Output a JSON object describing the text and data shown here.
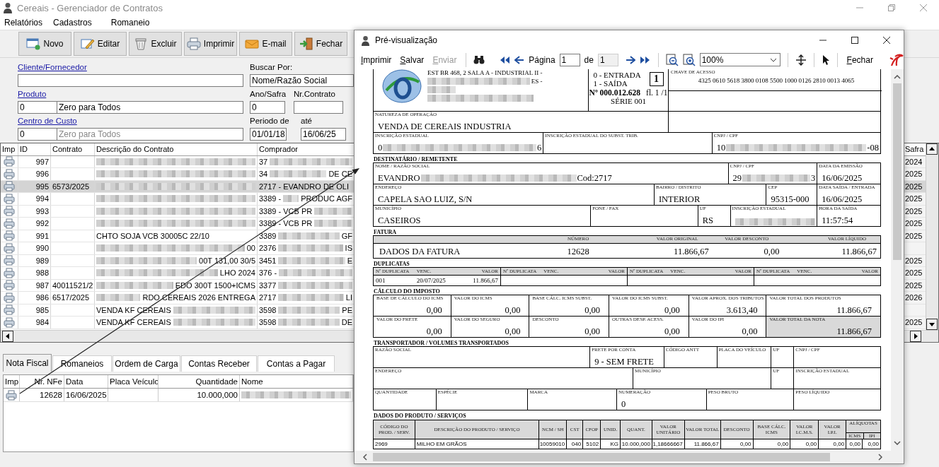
{
  "window": {
    "title": "Cereais - Gerenciador de Contratos"
  },
  "menu": [
    {
      "label": "Relatórios"
    },
    {
      "label": "Cadastros"
    },
    {
      "label": "Romaneio"
    }
  ],
  "toolbar": [
    {
      "label": "Novo",
      "kind": "new"
    },
    {
      "label": "Editar",
      "kind": "edit"
    },
    {
      "label": "Excluir",
      "kind": "delete"
    },
    {
      "label": "Imprimir",
      "kind": "print"
    },
    {
      "label": "E-mail",
      "kind": "email"
    },
    {
      "label": "Fechar",
      "kind": "close"
    }
  ],
  "filters": {
    "client": {
      "label": "Cliente/Fornecedor"
    },
    "search_by": {
      "label": "Buscar Por:",
      "value": "Nome/Razão Social"
    },
    "product": {
      "label": "Produto",
      "code": "0",
      "value": "Zero para Todos"
    },
    "harvest_year": {
      "label": "Ano/Safra",
      "value": "0"
    },
    "contract_number": {
      "label": "Nr.Contrato"
    },
    "cost_center": {
      "label": "Centro de Custo",
      "code": "0",
      "placeholder": "Zero para Todos"
    },
    "period_from": {
      "label": "Periodo de",
      "value": "01/01/18"
    },
    "period_to": {
      "label": "até",
      "value": "16/06/25"
    }
  },
  "contracts": {
    "columns": [
      "Imp",
      "ID",
      "Contrato",
      "Descrição do Contrato",
      "Comprador"
    ],
    "harvest_column": "Safra",
    "rows": [
      {
        "id": "997",
        "description": {
          "blurred": true
        },
        "buyer": {
          "value": "37",
          "blurred": true
        },
        "harvest": "2024",
        "selected": false
      },
      {
        "id": "996",
        "description": {
          "blurred": true
        },
        "buyer": {
          "value": "34",
          "blurred": true,
          "value_end": "DE CE"
        },
        "harvest": "2025",
        "selected": false
      },
      {
        "id": "995",
        "contract": "6573/2025",
        "description": {
          "blurred": true
        },
        "buyer": {
          "value": "2717 - EVANDRO DE OLI"
        },
        "harvest": "2025",
        "selected": true
      },
      {
        "id": "994",
        "description": {
          "blurred": true
        },
        "buyer": {
          "value": "3389 -",
          "blurred": true,
          "value_end": "PRODUC AGF"
        },
        "harvest": "2025",
        "selected": false
      },
      {
        "id": "993",
        "description": {
          "blurred": true
        },
        "buyer": {
          "value": "3389 - VCB PR",
          "blurred": true
        },
        "harvest": "2025",
        "selected": false
      },
      {
        "id": "992",
        "description": {
          "blurred": true
        },
        "buyer": {
          "value": "3389 - VCB PR",
          "blurred": true
        },
        "harvest": "2025",
        "selected": false
      },
      {
        "id": "991",
        "description": {
          "value": "CHTO SOJA VCB 30005C 22/10"
        },
        "buyer": {
          "value": "3389",
          "blurred": true,
          "value_end": "GF"
        },
        "harvest": "2025",
        "selected": false
      },
      {
        "id": "990",
        "description": {
          "blurred": true,
          "value_end": "00"
        },
        "buyer": {
          "value": "2376",
          "blurred": true,
          "value_end": "IS"
        },
        "selected": false
      },
      {
        "id": "989",
        "description": {
          "blurred": true,
          "value_end": "00T 131,00 30/5"
        },
        "buyer": {
          "value": "3451",
          "blurred": true,
          "value_end": "E"
        },
        "harvest": "2025",
        "selected": false
      },
      {
        "id": "988",
        "description": {
          "blurred": true,
          "value_end": "LHO 2024"
        },
        "buyer": {
          "value": "376 -",
          "blurred": true
        },
        "harvest": "2025",
        "selected": false
      },
      {
        "id": "987",
        "contract": "40011521/2",
        "description": {
          "blurred": true,
          "value_end": "EDO 300T 1500+ICMS"
        },
        "buyer": {
          "value": "3377",
          "blurred": true
        },
        "harvest": "2025",
        "selected": false
      },
      {
        "id": "986",
        "contract": "6517/2025",
        "description": {
          "blurred": true,
          "value_end": "RDO CEREAIS 2026 ENTREGA"
        },
        "buyer": {
          "value": "2717",
          "blurred": true,
          "value_end": "LI"
        },
        "harvest": "2026",
        "selected": false
      },
      {
        "id": "985",
        "description": {
          "value": "VENDA KF CEREAIS",
          "blurred": true
        },
        "buyer": {
          "value": "3598",
          "blurred": true,
          "value_end": "PE"
        },
        "selected": false
      },
      {
        "id": "984",
        "description": {
          "value": "VENDA KF CEREAIS",
          "blurred": true
        },
        "buyer": {
          "value": "3598",
          "blurred": true,
          "value_end": "DE"
        },
        "harvest": "2025",
        "selected": false
      }
    ]
  },
  "tabs": [
    {
      "label": "Nota Fiscal",
      "selected": true
    },
    {
      "label": "Romaneios",
      "selected": false
    },
    {
      "label": "Ordem de Carga",
      "selected": false
    },
    {
      "label": "Contas Receber",
      "selected": false
    },
    {
      "label": "Contas a Pagar",
      "selected": false
    }
  ],
  "invoices": {
    "columns": [
      "Imp",
      "Nr. NFe",
      "Data",
      "Placa Veículo",
      "Quantidade",
      "Nome"
    ],
    "rows": [
      {
        "number": "12628",
        "date": "16/06/2025",
        "quantity": "10.000,000",
        "name": {
          "blurred": true
        }
      }
    ]
  },
  "preview": {
    "title": "Pré-visualização",
    "toolbar": {
      "print": "Imprimir",
      "save": "Salvar",
      "send": {
        "label": "Enviar",
        "disabled": true
      },
      "page_label": "Página",
      "page": "1",
      "of_label": "de",
      "page_count": "1",
      "zoom": "100%",
      "close": "Fechar"
    },
    "danfe": {
      "emitter": {
        "address": "EST BR 468, 2 SALA A - INDUSTRIAL II -",
        "line_2_end": "ES -"
      },
      "operation": {
        "entry": "0 - ENTRADA",
        "exit": "1 - SAÍDA",
        "type": "1",
        "number": "Nº 000.012.628",
        "sheet": "fl. 1 /1",
        "series": "SÉRIE 001"
      },
      "access_key": {
        "label": "CHAVE DE ACESSO",
        "value": "4325 0610 5618 3800 0108 5500 1000 0126 2810 0013 4065"
      },
      "blocks": [
        {
          "kind": "fields",
          "cells": [
            {
              "label": "NATUREZA DE OPERAÇÃO",
              "value": "VENDA DE CEREAIS INDUSTRIA"
            }
          ]
        },
        {
          "kind": "fields",
          "cells": [
            {
              "label": "INSCRIÇÃO ESTADUAL",
              "value": "0",
              "blurred": true,
              "value_end": "6"
            },
            {
              "label": "INSCRIÇÃO ESTADUAL DO SUBST. TRIB."
            },
            {
              "label": "CNPJ / CPF",
              "value": "10",
              "blurred": true,
              "value_end": "-08"
            }
          ]
        },
        {
          "kind": "title",
          "text": "DESTINATÁRIO / REMETENTE"
        },
        {
          "kind": "fields",
          "cells": [
            {
              "label": "NOME / RAZÃO SOCIAL",
              "value": "EVANDRO",
              "blurred": true,
              "value_end": "Cod:2717"
            },
            {
              "label": "CNPJ / CPF",
              "value": "29",
              "blurred": true,
              "value_end": "3"
            },
            {
              "label": "DATA DA EMISSÃO",
              "value": "16/06/2025"
            }
          ]
        },
        {
          "kind": "fields",
          "cells": [
            {
              "label": "ENDEREÇO",
              "value": "CAPELA SAO LUIZ, S/N"
            },
            {
              "label": "BAIRRO / DISTRITO",
              "value": "INTERIOR"
            },
            {
              "label": "CEP",
              "value": "95315-000"
            },
            {
              "label": "DATA SAÍDA / ENTRADA",
              "value": "16/06/2025"
            }
          ]
        },
        {
          "kind": "fields",
          "cells": [
            {
              "label": "MUNICÍPIO",
              "value": "CASEIROS"
            },
            {
              "label": "FONE / FAX"
            },
            {
              "label": "UF",
              "value": "RS"
            },
            {
              "label": "INSCRIÇÃO ESTADUAL",
              "blurred": true
            },
            {
              "label": "HORA DA SAÍDA",
              "value": "11:57:54"
            }
          ]
        },
        {
          "kind": "title",
          "text": "FATURA"
        },
        {
          "kind": "summary",
          "cells": [
            {
              "value": "DADOS DA FATURA"
            },
            {
              "label": "NÚMERO",
              "value": "12628"
            },
            {
              "label": "VALOR ORIGINAL",
              "value": "11.866,67"
            },
            {
              "label": "VALOR DESCONTO",
              "value": "0,00"
            },
            {
              "label": "VALOR LÍQUIDO",
              "value": "11.866,67"
            }
          ]
        },
        {
          "kind": "title",
          "text": "DUPLICATAS"
        },
        {
          "kind": "installments",
          "groups": [
            {
              "labels": [
                "Nº DUPLICATA",
                "VENC.",
                "VALOR"
              ],
              "values": [
                "001",
                "20/07/2025",
                "11.866,67"
              ]
            },
            {
              "labels": [
                "Nº DUPLICATA",
                "VENC.",
                "VALOR"
              ]
            },
            {
              "labels": [
                "Nº DUPLICATA",
                "VENC.",
                "VALOR"
              ]
            },
            {
              "labels": [
                "Nº DUPLICATA",
                "VENC.",
                "VALOR"
              ]
            }
          ]
        },
        {
          "kind": "title",
          "text": "CÁLCULO DO IMPOSTO"
        },
        {
          "kind": "amounts",
          "cells": [
            {
              "label": "BASE DE CÁLCULO DO ICMS",
              "value": "0,00",
              "highlighted": false
            },
            {
              "label": "VALOR DO ICMS",
              "value": "0,00",
              "highlighted": false
            },
            {
              "label": "BASE CÁLC. ICMS SUBST.",
              "value": "0,00",
              "highlighted": false
            },
            {
              "label": "VALOR DO ICMS SUBST.",
              "value": "0,00",
              "highlighted": false
            },
            {
              "label": "VALOR APROX. DOS TRIBUTOS",
              "value": "3.613,40",
              "highlighted": false
            },
            {
              "label": "VALOR TOTAL DOS PRODUTOS",
              "value": "11.866,67",
              "highlighted": false
            }
          ]
        },
        {
          "kind": "amounts",
          "cells": [
            {
              "label": "VALOR DO FRETE",
              "value": "0,00",
              "highlighted": false
            },
            {
              "label": "VALOR DO SEGURO",
              "value": "0,00",
              "highlighted": false
            },
            {
              "label": "DESCONTO",
              "value": "0,00",
              "highlighted": false
            },
            {
              "label": "OUTRAS DESP. ACESS.",
              "value": "0,00",
              "highlighted": false
            },
            {
              "label": "VALOR DO IPI",
              "value": "0,00",
              "highlighted": false
            },
            {
              "label": "VALOR TOTAL DA NOTA",
              "value": "11.866,67",
              "highlighted": true
            }
          ]
        },
        {
          "kind": "title",
          "text": "TRANSPORTADOR / VOLUMES TRANSPORTADOS"
        },
        {
          "kind": "fields",
          "cells": [
            {
              "label": "RAZÃO SOCIAL"
            },
            {
              "label": "FRETE POR CONTA",
              "value": "9 - SEM FRETE"
            },
            {
              "label": "CÓDIGO ANTT"
            },
            {
              "label": "PLACA DO VEÍCULO"
            },
            {
              "label": "UF"
            },
            {
              "label": "CNPJ / CPF"
            }
          ]
        },
        {
          "kind": "fields",
          "cells": [
            {
              "label": "ENDEREÇO"
            },
            {
              "label": "MUNICÍPIO"
            },
            {
              "label": "UF"
            },
            {
              "label": "INSCRIÇÃO ESTADUAL"
            }
          ]
        },
        {
          "kind": "fields",
          "cells": [
            {
              "label": "QUANTIDADE"
            },
            {
              "label": "ESPÉCIE"
            },
            {
              "label": "MARCA"
            },
            {
              "label": "NUMERAÇÃO",
              "value": "0"
            },
            {
              "label": "PESO BRUTO"
            },
            {
              "label": "PESO LÍQUIDO"
            }
          ]
        },
        {
          "kind": "title",
          "text": "DADOS DO PRODUTO / SERVIÇOS"
        },
        {
          "kind": "items",
          "columns": [
            {
              "label": "CÓDIGO DO PROD. / SERV."
            },
            {
              "label": "DESCRIÇÃO DO PRODUTO / SERVIÇO"
            },
            {
              "label": "NCM / SH"
            },
            {
              "label": "CST"
            },
            {
              "label": "CFOP"
            },
            {
              "label": "UNID."
            },
            {
              "label": "QUANT."
            },
            {
              "label": "VALOR UNITÁRIO"
            },
            {
              "label": "VALOR TOTAL"
            },
            {
              "label": "DESCONTO"
            },
            {
              "label": "BASE CÁLC. ICMS"
            },
            {
              "label": "VALOR I.C.M.S."
            },
            {
              "label": "VALOR I.P.I."
            },
            {
              "label": "ALÍQUOTAS",
              "sub": [
                "ICMS",
                "IPI"
              ]
            }
          ],
          "rows": [
            [
              "2969",
              "MILHO EM GRÃOS",
              "10059010",
              "040",
              "5102",
              "KG",
              "10.000,000",
              "1,18666667",
              "11.866,67",
              "0,00",
              "0,00",
              "0,00",
              "0,00",
              "0,00",
              "0,00"
            ]
          ]
        }
      ]
    }
  }
}
